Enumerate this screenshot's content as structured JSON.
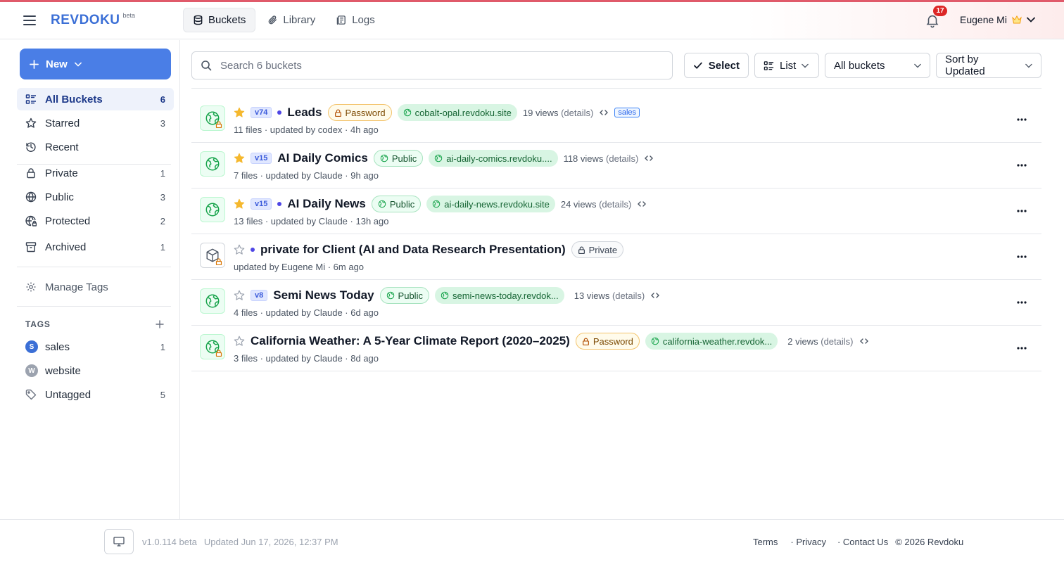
{
  "header": {
    "logo": "REVDOKU",
    "logo_badge": "beta",
    "nav": [
      {
        "label": "Buckets",
        "icon": "database-icon",
        "active": true
      },
      {
        "label": "Library",
        "icon": "paperclip-icon",
        "active": false
      },
      {
        "label": "Logs",
        "icon": "logs-icon",
        "active": false
      }
    ],
    "notifications_count": "17",
    "user_name": "Eugene Mi"
  },
  "sidebar": {
    "new_button": "New",
    "items": [
      {
        "label": "All Buckets",
        "count": "6",
        "icon": "list-icon"
      },
      {
        "label": "Starred",
        "count": "3",
        "icon": "star-icon"
      },
      {
        "label": "Recent",
        "count": "",
        "icon": "history-icon"
      },
      {
        "label": "Private",
        "count": "1",
        "icon": "lock-icon"
      },
      {
        "label": "Public",
        "count": "3",
        "icon": "globe-icon"
      },
      {
        "label": "Protected",
        "count": "2",
        "icon": "globe-lock-icon"
      },
      {
        "label": "Archived",
        "count": "1",
        "icon": "archive-icon"
      }
    ],
    "manage_tags": "Manage Tags",
    "tags_heading": "TAGS",
    "tags": [
      {
        "label": "sales",
        "count": "1",
        "letter": "S",
        "color": "#3b6fd6"
      },
      {
        "label": "website",
        "count": "",
        "letter": "W",
        "color": "#9ca3af"
      },
      {
        "label": "Untagged",
        "count": "5",
        "letter": "",
        "color": ""
      }
    ]
  },
  "toolbar": {
    "search_placeholder": "Search 6 buckets",
    "select_label": "Select",
    "view_label": "List",
    "filter_label": "All buckets",
    "sort_label": "Sort by Updated"
  },
  "buckets": [
    {
      "title": "Leads",
      "version": "v74",
      "starred": true,
      "dot": true,
      "access": "Password",
      "site": "cobalt-opal.revdoku.site",
      "views": "19 views",
      "details": "(details)",
      "tag": "sales",
      "files": "11 files",
      "updated_by": "updated by codex",
      "ago": "4h ago"
    },
    {
      "title": "AI Daily Comics",
      "version": "v15",
      "starred": true,
      "dot": false,
      "access": "Public",
      "site": "ai-daily-comics.revdoku....",
      "views": "118 views",
      "details": "(details)",
      "tag": "",
      "files": "7 files",
      "updated_by": "updated by Claude",
      "ago": "9h ago"
    },
    {
      "title": "AI Daily News",
      "version": "v15",
      "starred": true,
      "dot": true,
      "access": "Public",
      "site": "ai-daily-news.revdoku.site",
      "views": "24 views",
      "details": "(details)",
      "tag": "",
      "files": "13 files",
      "updated_by": "updated by Claude",
      "ago": "13h ago"
    },
    {
      "title": "private for Client (AI and Data Research Presentation)",
      "version": "",
      "starred": false,
      "dot": true,
      "access": "Private",
      "site": "",
      "views": "",
      "details": "",
      "tag": "",
      "files": "",
      "updated_by": "updated by Eugene Mi",
      "ago": "6m ago"
    },
    {
      "title": "Semi News Today",
      "version": "v8",
      "starred": false,
      "dot": false,
      "access": "Public",
      "site": "semi-news-today.revdok...",
      "views": "13 views",
      "details": "(details)",
      "tag": "",
      "files": "4 files",
      "updated_by": "updated by Claude",
      "ago": "6d ago"
    },
    {
      "title": "California Weather: A 5-Year Climate Report (2020–2025)",
      "version": "",
      "starred": false,
      "dot": false,
      "access": "Password",
      "site": "california-weather.revdok...",
      "views": "2 views",
      "details": "(details)",
      "tag": "",
      "files": "3 files",
      "updated_by": "updated by Claude",
      "ago": "8d ago"
    }
  ],
  "footer": {
    "version": "v1.0.114 beta",
    "updated": "Updated Jun 17, 2026, 12:37 PM",
    "terms": "Terms",
    "privacy": "· Privacy",
    "contact": "· Contact Us",
    "copyright": "© 2026 Revdoku"
  },
  "colors": {
    "accent": "#4a7ee6",
    "star": "#f5b82e",
    "site_bg": "#d8f5e3",
    "badge": "#dc2626"
  }
}
